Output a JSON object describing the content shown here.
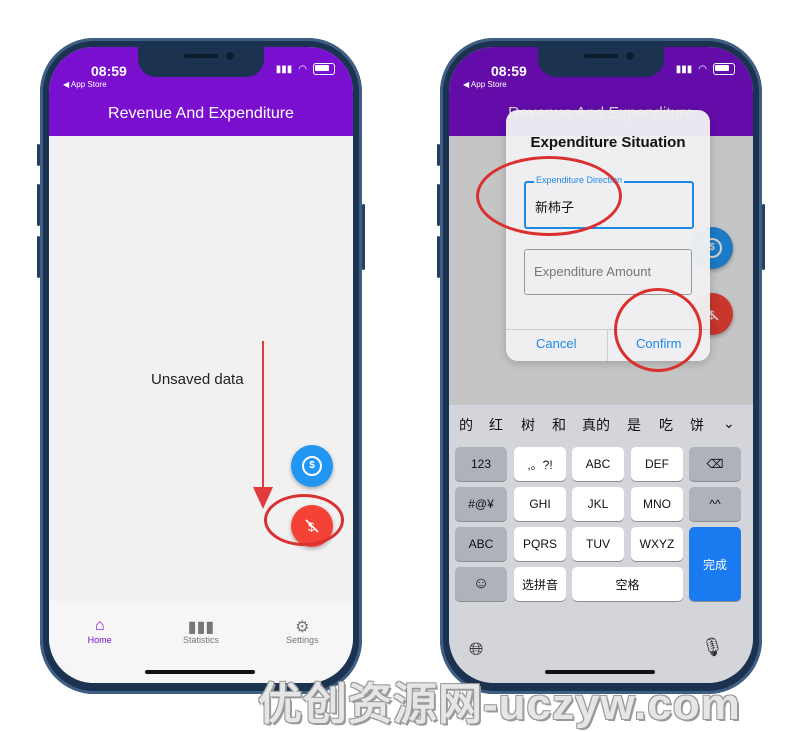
{
  "status_bar": {
    "time": "08:59",
    "back_app": "◀ App Store"
  },
  "left_screen": {
    "app_title": "Revenue And Expenditure",
    "content_text": "Unsaved data",
    "fab_income_icon": "dollar-circle-icon",
    "fab_expense_icon": "no-money-icon",
    "bottom_nav": [
      {
        "label": "Home",
        "icon": "home-icon",
        "active": true
      },
      {
        "label": "Statistics",
        "icon": "bar-chart-icon",
        "active": false
      },
      {
        "label": "Settings",
        "icon": "gear-icon",
        "active": false
      }
    ]
  },
  "right_screen": {
    "app_title_partial": "Revenue And Expenditure",
    "dialog": {
      "title": "Expenditure Situation",
      "direction_label": "Expenditure Direction",
      "direction_value": "新柿子",
      "amount_placeholder": "Expenditure Amount",
      "cancel_label": "Cancel",
      "confirm_label": "Confirm"
    },
    "keyboard": {
      "candidates": [
        "的",
        "红",
        "树",
        "和",
        "真的",
        "是",
        "吃",
        "饼"
      ],
      "rows": [
        [
          "123",
          ",。?!",
          "ABC",
          "DEF",
          "⌫"
        ],
        [
          "#@¥",
          "GHI",
          "JKL",
          "MNO",
          "^^"
        ],
        [
          "ABC",
          "PQRS",
          "TUV",
          "WXYZ",
          "完成"
        ],
        [
          "☺",
          "选拼音",
          "空格"
        ]
      ]
    }
  },
  "watermark": "优创资源网-uczyw.com",
  "colors": {
    "app_bar": "#7b0fd0",
    "fab_blue": "#2196f3",
    "fab_red": "#f44336",
    "annotation": "#d9312f",
    "accent_blue": "#1e88e5"
  }
}
